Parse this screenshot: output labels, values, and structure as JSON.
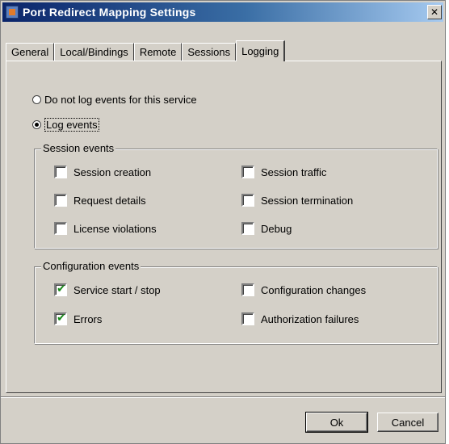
{
  "window": {
    "title": "Port Redirect Mapping Settings",
    "close_glyph": "✕"
  },
  "tabs": [
    "General",
    "Local/Bindings",
    "Remote",
    "Sessions",
    "Logging"
  ],
  "active_tab": "Logging",
  "logging": {
    "radio_no_log": "Do not log events for this service",
    "radio_log": "Log events",
    "selected": "Log events"
  },
  "session_events": {
    "title": "Session events",
    "items": [
      {
        "label": "Session creation",
        "checked": false
      },
      {
        "label": "Session traffic",
        "checked": false
      },
      {
        "label": "Request details",
        "checked": false
      },
      {
        "label": "Session termination",
        "checked": false
      },
      {
        "label": "License violations",
        "checked": false
      },
      {
        "label": "Debug",
        "checked": false
      }
    ]
  },
  "config_events": {
    "title": "Configuration events",
    "items": [
      {
        "label": "Service start / stop",
        "checked": true
      },
      {
        "label": "Configuration changes",
        "checked": false
      },
      {
        "label": "Errors",
        "checked": true
      },
      {
        "label": "Authorization failures",
        "checked": false
      }
    ]
  },
  "buttons": {
    "ok": "Ok",
    "cancel": "Cancel"
  },
  "colors": {
    "face": "#d4d0c8",
    "title_start": "#0a246a",
    "title_end": "#a6caf0",
    "check": "#1b8a1b"
  }
}
